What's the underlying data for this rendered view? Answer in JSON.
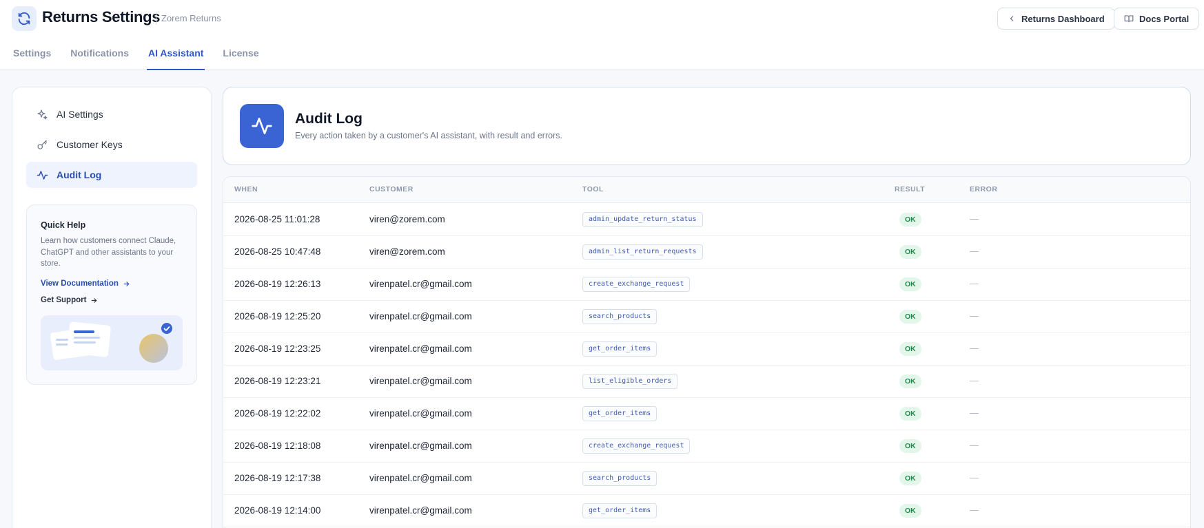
{
  "header": {
    "title": "Returns Settings",
    "subtitle": "Zorem Returns",
    "buttons": {
      "dashboard": "Returns Dashboard",
      "docs": "Docs Portal"
    }
  },
  "tabs": [
    {
      "label": "Settings",
      "active": false
    },
    {
      "label": "Notifications",
      "active": false
    },
    {
      "label": "AI Assistant",
      "active": true
    },
    {
      "label": "License",
      "active": false
    }
  ],
  "sidebar": {
    "items": [
      {
        "label": "AI Settings",
        "icon": "sparkles-icon",
        "active": false
      },
      {
        "label": "Customer Keys",
        "icon": "key-icon",
        "active": false
      },
      {
        "label": "Audit Log",
        "icon": "activity-icon",
        "active": true
      }
    ],
    "help": {
      "title": "Quick Help",
      "text": "Learn how customers connect Claude, ChatGPT and other assistants to your store.",
      "doc_link": "View Documentation",
      "support_link": "Get Support"
    }
  },
  "main": {
    "title": "Audit Log",
    "subtitle": "Every action taken by a customer's AI assistant, with result and errors.",
    "columns": {
      "when": "WHEN",
      "customer": "CUSTOMER",
      "tool": "TOOL",
      "result": "RESULT",
      "error": "ERROR"
    },
    "rows": [
      {
        "when": "2026-08-25 11:01:28",
        "customer": "viren@zorem.com",
        "tool": "admin_update_return_status",
        "result": "OK",
        "error": "—"
      },
      {
        "when": "2026-08-25 10:47:48",
        "customer": "viren@zorem.com",
        "tool": "admin_list_return_requests",
        "result": "OK",
        "error": "—"
      },
      {
        "when": "2026-08-19 12:26:13",
        "customer": "virenpatel.cr@gmail.com",
        "tool": "create_exchange_request",
        "result": "OK",
        "error": "—"
      },
      {
        "when": "2026-08-19 12:25:20",
        "customer": "virenpatel.cr@gmail.com",
        "tool": "search_products",
        "result": "OK",
        "error": "—"
      },
      {
        "when": "2026-08-19 12:23:25",
        "customer": "virenpatel.cr@gmail.com",
        "tool": "get_order_items",
        "result": "OK",
        "error": "—"
      },
      {
        "when": "2026-08-19 12:23:21",
        "customer": "virenpatel.cr@gmail.com",
        "tool": "list_eligible_orders",
        "result": "OK",
        "error": "—"
      },
      {
        "when": "2026-08-19 12:22:02",
        "customer": "virenpatel.cr@gmail.com",
        "tool": "get_order_items",
        "result": "OK",
        "error": "—"
      },
      {
        "when": "2026-08-19 12:18:08",
        "customer": "virenpatel.cr@gmail.com",
        "tool": "create_exchange_request",
        "result": "OK",
        "error": "—"
      },
      {
        "when": "2026-08-19 12:17:38",
        "customer": "virenpatel.cr@gmail.com",
        "tool": "search_products",
        "result": "OK",
        "error": "—"
      },
      {
        "when": "2026-08-19 12:14:00",
        "customer": "virenpatel.cr@gmail.com",
        "tool": "get_order_items",
        "result": "OK",
        "error": "—"
      }
    ]
  },
  "colors": {
    "accent": "#2f55c9",
    "hero_icon_bg": "#3a63d4",
    "ok_bg": "#e3f6ea",
    "ok_text": "#1f8a4c"
  }
}
